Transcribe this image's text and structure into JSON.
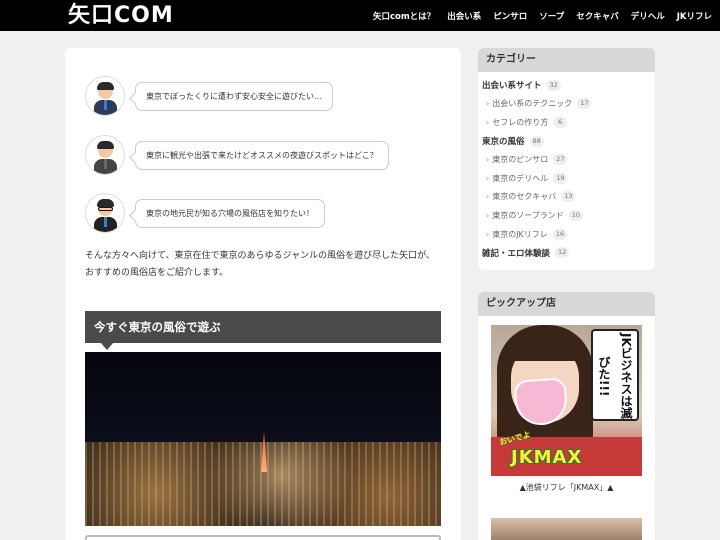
{
  "site": {
    "logo": "矢口COM"
  },
  "nav": [
    "矢口comとは？",
    "出会い系",
    "ピンサロ",
    "ソープ",
    "セクキャバ",
    "デリヘル",
    "JKリフレ"
  ],
  "talks": [
    "東京でぼったくりに遭わず安心安全に遊びたい…",
    "東京に観光や出張で来たけどオススメの夜遊びスポットはどこ？",
    "東京の地元民が知る穴場の風俗店を知りたい！"
  ],
  "intro": "そんな方々へ向けて、東京在住で東京のあらゆるジャンルの風俗を遊び尽した矢口が、おすすめの風俗店をご紹介します。",
  "section": {
    "title": "今すぐ東京の風俗で遊ぶ"
  },
  "categories": {
    "title": "カテゴリー",
    "items": [
      {
        "label": "出会い系サイト",
        "count": "32"
      },
      {
        "label": "出会い系のテクニック",
        "count": "17"
      },
      {
        "label": "セフレの作り方",
        "count": "6"
      },
      {
        "label": "東京の風俗",
        "count": "88"
      },
      {
        "label": "東京のピンサロ",
        "count": "27"
      },
      {
        "label": "東京のデリヘル",
        "count": "19"
      },
      {
        "label": "東京のセクキャバ",
        "count": "13"
      },
      {
        "label": "東京のソープランド",
        "count": "10"
      },
      {
        "label": "東京のJKリフレ",
        "count": "16"
      },
      {
        "label": "雑記・エロ体験談",
        "count": "12"
      }
    ]
  },
  "pickup": {
    "title": "ピックアップ店",
    "sign_text": "JKビジネスは滅びた!!!",
    "logo_small": "おいでよ",
    "logo": "JKMAX",
    "caption": "▲池袋リフレ「JKMAX」▲"
  },
  "icons": {
    "chevron": "chevron-right-icon"
  }
}
